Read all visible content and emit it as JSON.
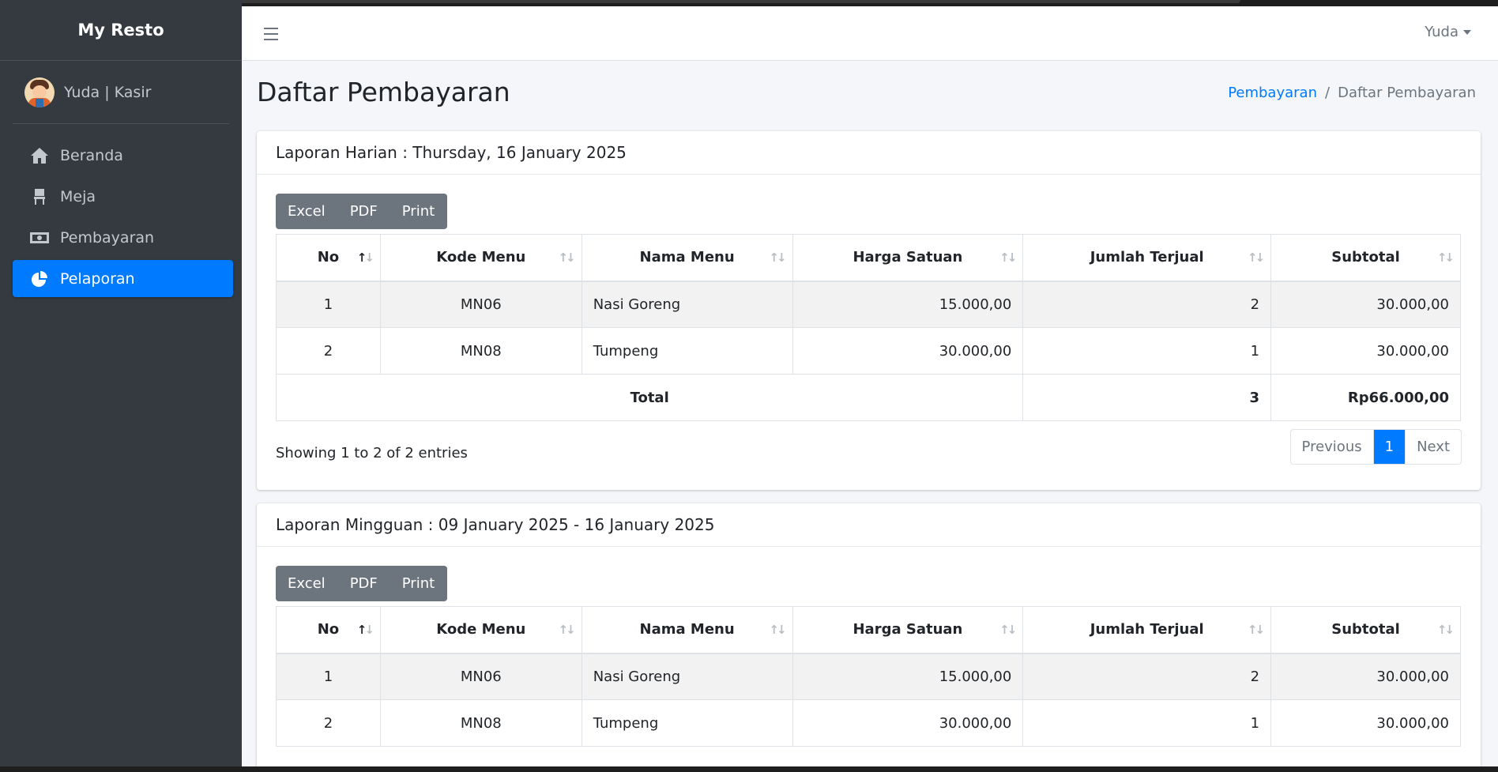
{
  "app": {
    "brand": "My Resto"
  },
  "user_panel": {
    "name": "Yuda | Kasir"
  },
  "sidebar": {
    "items": [
      {
        "label": "Beranda",
        "icon": "home-icon"
      },
      {
        "label": "Meja",
        "icon": "chair-icon"
      },
      {
        "label": "Pembayaran",
        "icon": "money-bill-icon"
      },
      {
        "label": "Pelaporan",
        "icon": "chart-pie-icon",
        "active": true
      }
    ]
  },
  "topbar": {
    "user": "Yuda"
  },
  "page": {
    "title": "Daftar Pembayaran",
    "breadcrumb": {
      "link": "Pembayaran",
      "separator": "/",
      "current": "Daftar Pembayaran"
    }
  },
  "reports": [
    {
      "title": "Laporan Harian : Thursday, 16 January 2025",
      "buttons": [
        "Excel",
        "PDF",
        "Print"
      ],
      "columns": [
        "No",
        "Kode Menu",
        "Nama Menu",
        "Harga Satuan",
        "Jumlah Terjual",
        "Subtotal"
      ],
      "rows": [
        [
          "1",
          "MN06",
          "Nasi Goreng",
          "15.000,00",
          "2",
          "30.000,00"
        ],
        [
          "2",
          "MN08",
          "Tumpeng",
          "30.000,00",
          "1",
          "30.000,00"
        ]
      ],
      "total": {
        "label": "Total",
        "qty": "3",
        "amount": "Rp66.000,00"
      },
      "info": "Showing 1 to 2 of 2 entries",
      "pagination": {
        "previous": "Previous",
        "current": "1",
        "next": "Next"
      }
    },
    {
      "title": "Laporan Mingguan : 09 January 2025 - 16 January 2025",
      "buttons": [
        "Excel",
        "PDF",
        "Print"
      ],
      "columns": [
        "No",
        "Kode Menu",
        "Nama Menu",
        "Harga Satuan",
        "Jumlah Terjual",
        "Subtotal"
      ],
      "rows": [
        [
          "1",
          "MN06",
          "Nasi Goreng",
          "15.000,00",
          "2",
          "30.000,00"
        ],
        [
          "2",
          "MN08",
          "Tumpeng",
          "30.000,00",
          "1",
          "30.000,00"
        ]
      ]
    }
  ],
  "colors": {
    "sidebar_bg": "#343a40",
    "accent": "#007bff",
    "button_bg": "#6c757d",
    "content_bg": "#f4f6f9"
  }
}
